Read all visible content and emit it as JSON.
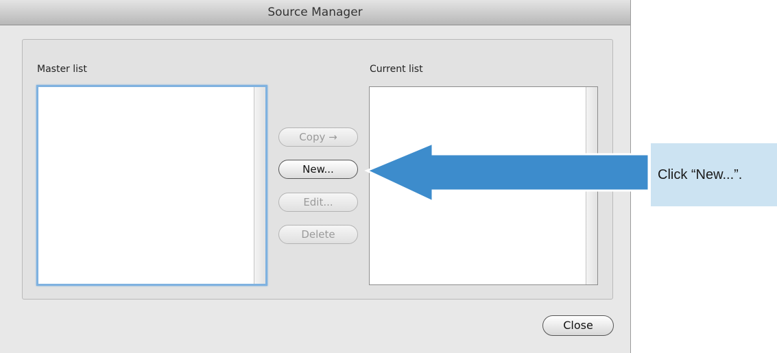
{
  "window": {
    "title": "Source Manager"
  },
  "master_list": {
    "label": "Master list",
    "items": []
  },
  "current_list": {
    "label": "Current list",
    "items": []
  },
  "buttons": {
    "copy": {
      "label": "Copy →",
      "enabled": false
    },
    "new": {
      "label": "New...",
      "enabled": true
    },
    "edit": {
      "label": "Edit...",
      "enabled": false
    },
    "delete": {
      "label": "Delete",
      "enabled": false
    },
    "close": {
      "label": "Close",
      "enabled": true
    }
  },
  "annotation": {
    "text": "Click “New...”.",
    "arrow_color": "#3d8ccc",
    "callout_color": "#cce3f2"
  }
}
